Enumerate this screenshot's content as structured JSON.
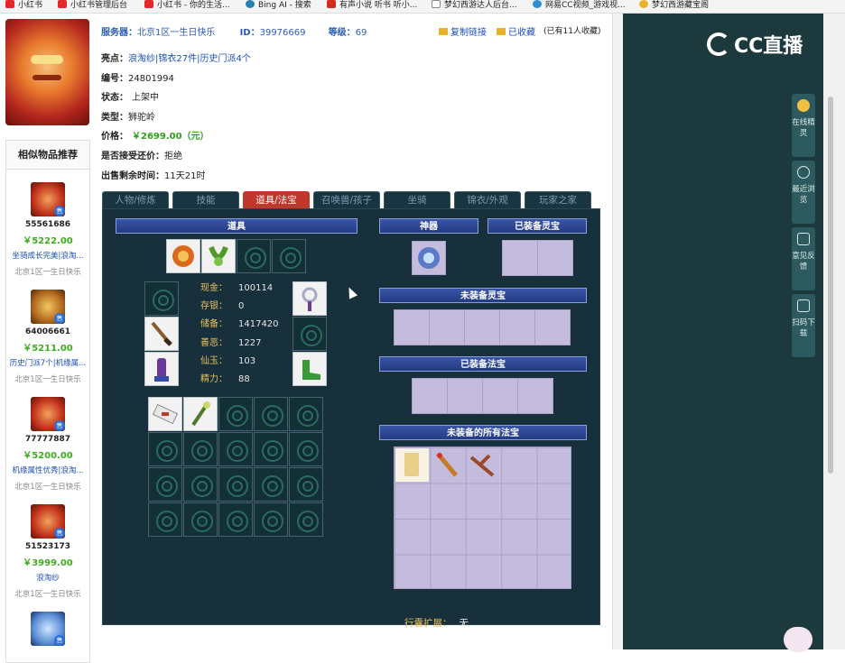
{
  "bookmarks": [
    {
      "label": "小红书",
      "icon": "xiaohongshu-icon"
    },
    {
      "label": "小红书管理后台",
      "icon": "xiaohongshu-icon"
    },
    {
      "label": "小红书 - 你的生活...",
      "icon": "xiaohongshu-icon"
    },
    {
      "label": "Bing AI - 搜索",
      "icon": "bing-icon"
    },
    {
      "label": "有声小说 听书 听小...",
      "icon": "audiobook-icon"
    },
    {
      "label": "梦幻西游达人后台...",
      "icon": "page-icon"
    },
    {
      "label": "网易CC视频_游戏视...",
      "icon": "cc-icon"
    },
    {
      "label": "梦幻西游藏宝阁",
      "icon": "treasure-icon"
    }
  ],
  "similar": {
    "title": "相似物品推荐",
    "sell_tag": "售",
    "items": [
      {
        "id": "55561686",
        "price": "￥5222.00",
        "desc": "坐骑成长完美|浪淘...",
        "server": "北京1区一生日快乐"
      },
      {
        "id": "64006661",
        "price": "￥5211.00",
        "desc": "历史门派7个|机缘属...",
        "server": "北京1区一生日快乐"
      },
      {
        "id": "77777887",
        "price": "￥5200.00",
        "desc": "机缘属性优秀|浪淘...",
        "server": "北京1区一生日快乐"
      },
      {
        "id": "51523173",
        "price": "￥3999.00",
        "desc": "浪淘纱",
        "server": "北京1区一生日快乐"
      },
      {
        "id": "",
        "price": "",
        "desc": "",
        "server": ""
      }
    ]
  },
  "info": {
    "server_label": "服务器：",
    "server": "北京1区一生日快乐",
    "id_label": "ID：",
    "id": "39976669",
    "level_label": "等级：",
    "level": "69",
    "copy_link": "复制链接",
    "favorited": "已收藏",
    "fav_count": "(已有11人收藏)"
  },
  "details": {
    "highlight_label": "亮点：",
    "highlights": [
      "浪淘纱",
      "锦衣27件",
      "历史门派4个"
    ],
    "number_label": "编号：",
    "number": "24801994",
    "status_label": "状态：",
    "status": "上架中",
    "type_label": "类型：",
    "type": "狮驼岭",
    "price_label": "价格：",
    "price": "￥2699.00（元）",
    "bargain_label": "是否接受还价：",
    "bargain": "拒绝",
    "remaining_label": "出售剩余时间：",
    "remaining": "11天21时"
  },
  "tabs": [
    "人物/修炼",
    "技能",
    "道具/法宝",
    "召唤兽/孩子",
    "坐骑",
    "锦衣/外观",
    "玩家之家"
  ],
  "active_tab": 2,
  "panel": {
    "items_header": "道具",
    "artifact_header": "神器",
    "equipped_spirit_header": "已装备灵宝",
    "unequipped_spirit_header": "未装备灵宝",
    "equipped_treasure_header": "已装备法宝",
    "all_treasure_header": "未装备的所有法宝",
    "stats": [
      {
        "label": "现金：",
        "value": "100114"
      },
      {
        "label": "存银：",
        "value": "0"
      },
      {
        "label": "储备：",
        "value": "1417420"
      },
      {
        "label": "善恶：",
        "value": "1227"
      },
      {
        "label": "仙玉：",
        "value": "103"
      },
      {
        "label": "精力：",
        "value": "88"
      }
    ],
    "bag_expand_label": "行囊扩展：",
    "bag_expand_value": "无"
  },
  "right": {
    "logo": "CC直播",
    "side_buttons": [
      {
        "label": "在线精灵",
        "icon": "assistant-icon"
      },
      {
        "label": "最近浏览",
        "icon": "clock-icon"
      },
      {
        "label": "意见反馈",
        "icon": "feedback-icon"
      },
      {
        "label": "扫码下载",
        "icon": "qrcode-icon"
      }
    ]
  },
  "colors": {
    "accent_red": "#c0382b",
    "price_green": "#2fa01a",
    "link_blue": "#1a4fb5",
    "panel_bg": "#17303c",
    "slot_lavender": "#c3bcdc",
    "stat_label": "#e8c15a"
  }
}
